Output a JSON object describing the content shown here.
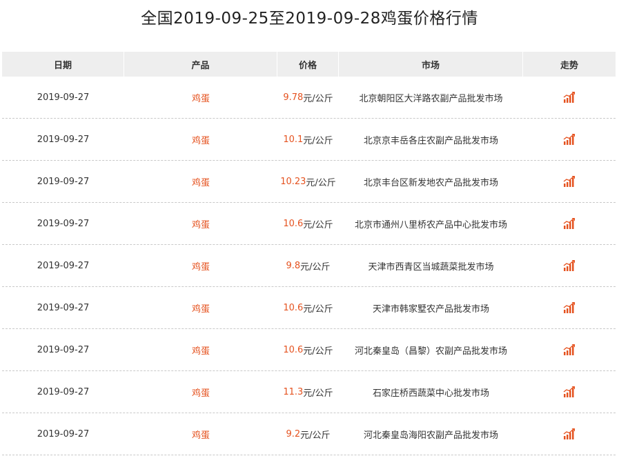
{
  "page": {
    "title": "全国2019-09-25至2019-09-28鸡蛋价格行情"
  },
  "colors": {
    "accent": "#e5521f",
    "header_bg": "#eeeeee",
    "divider": "#c8c8c8"
  },
  "table": {
    "headers": [
      "日期",
      "产品",
      "价格",
      "市场",
      "走势"
    ],
    "rows": [
      {
        "date": "2019-09-27",
        "product": "鸡蛋",
        "price": "9.78",
        "unit": "元/公斤",
        "market": "北京朝阳区大洋路农副产品批发市场",
        "trend_icon": "trend-chart-icon"
      },
      {
        "date": "2019-09-27",
        "product": "鸡蛋",
        "price": "10.1",
        "unit": "元/公斤",
        "market": "北京京丰岳各庄农副产品批发市场",
        "trend_icon": "trend-chart-icon"
      },
      {
        "date": "2019-09-27",
        "product": "鸡蛋",
        "price": "10.23",
        "unit": "元/公斤",
        "market": "北京丰台区新发地农产品批发市场",
        "trend_icon": "trend-chart-icon"
      },
      {
        "date": "2019-09-27",
        "product": "鸡蛋",
        "price": "10.6",
        "unit": "元/公斤",
        "market": "北京市通州八里桥农产品中心批发市场",
        "trend_icon": "trend-chart-icon"
      },
      {
        "date": "2019-09-27",
        "product": "鸡蛋",
        "price": "9.8",
        "unit": "元/公斤",
        "market": "天津市西青区当城蔬菜批发市场",
        "trend_icon": "trend-chart-icon"
      },
      {
        "date": "2019-09-27",
        "product": "鸡蛋",
        "price": "10.6",
        "unit": "元/公斤",
        "market": "天津市韩家墅农产品批发市场",
        "trend_icon": "trend-chart-icon"
      },
      {
        "date": "2019-09-27",
        "product": "鸡蛋",
        "price": "10.6",
        "unit": "元/公斤",
        "market": "河北秦皇岛（昌黎）农副产品批发市场",
        "trend_icon": "trend-chart-icon"
      },
      {
        "date": "2019-09-27",
        "product": "鸡蛋",
        "price": "11.3",
        "unit": "元/公斤",
        "market": "石家庄桥西蔬菜中心批发市场",
        "trend_icon": "trend-chart-icon"
      },
      {
        "date": "2019-09-27",
        "product": "鸡蛋",
        "price": "9.2",
        "unit": "元/公斤",
        "market": "河北秦皇岛海阳农副产品批发市场",
        "trend_icon": "trend-chart-icon"
      }
    ]
  }
}
